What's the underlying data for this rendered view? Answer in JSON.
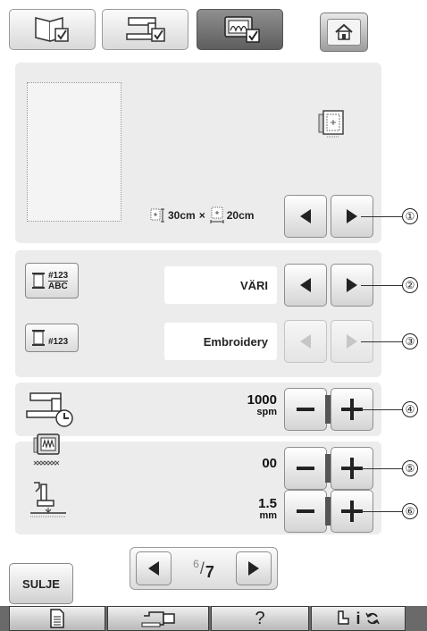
{
  "top_tabs": [
    {
      "icon": "book-check-icon",
      "active": false
    },
    {
      "icon": "machine-check-icon",
      "active": false
    },
    {
      "icon": "hoop-check-icon",
      "active": true
    }
  ],
  "home_icon": "home-icon",
  "hoop_section": {
    "hoop_icon": "embroidery-frame-icon",
    "width": "30cm",
    "times": "×",
    "height": "20cm",
    "callout": "①"
  },
  "thread_display": {
    "value": "VÄRI",
    "badge_top": "#123",
    "badge_bottom": "ABC",
    "callout": "②"
  },
  "thread_number": {
    "value": "Embroidery",
    "badge": "#123",
    "callout": "③"
  },
  "speed": {
    "value": "1000",
    "unit": "spm",
    "callout": "④"
  },
  "tension": {
    "value": "00",
    "callout": "⑤"
  },
  "foot_height": {
    "value": "1.5",
    "unit": "mm",
    "callout": "⑥"
  },
  "pagination": {
    "current": "6",
    "total": "7"
  },
  "close_label": "SULJE",
  "bottom_bar": {
    "help": "?",
    "info": "i"
  }
}
